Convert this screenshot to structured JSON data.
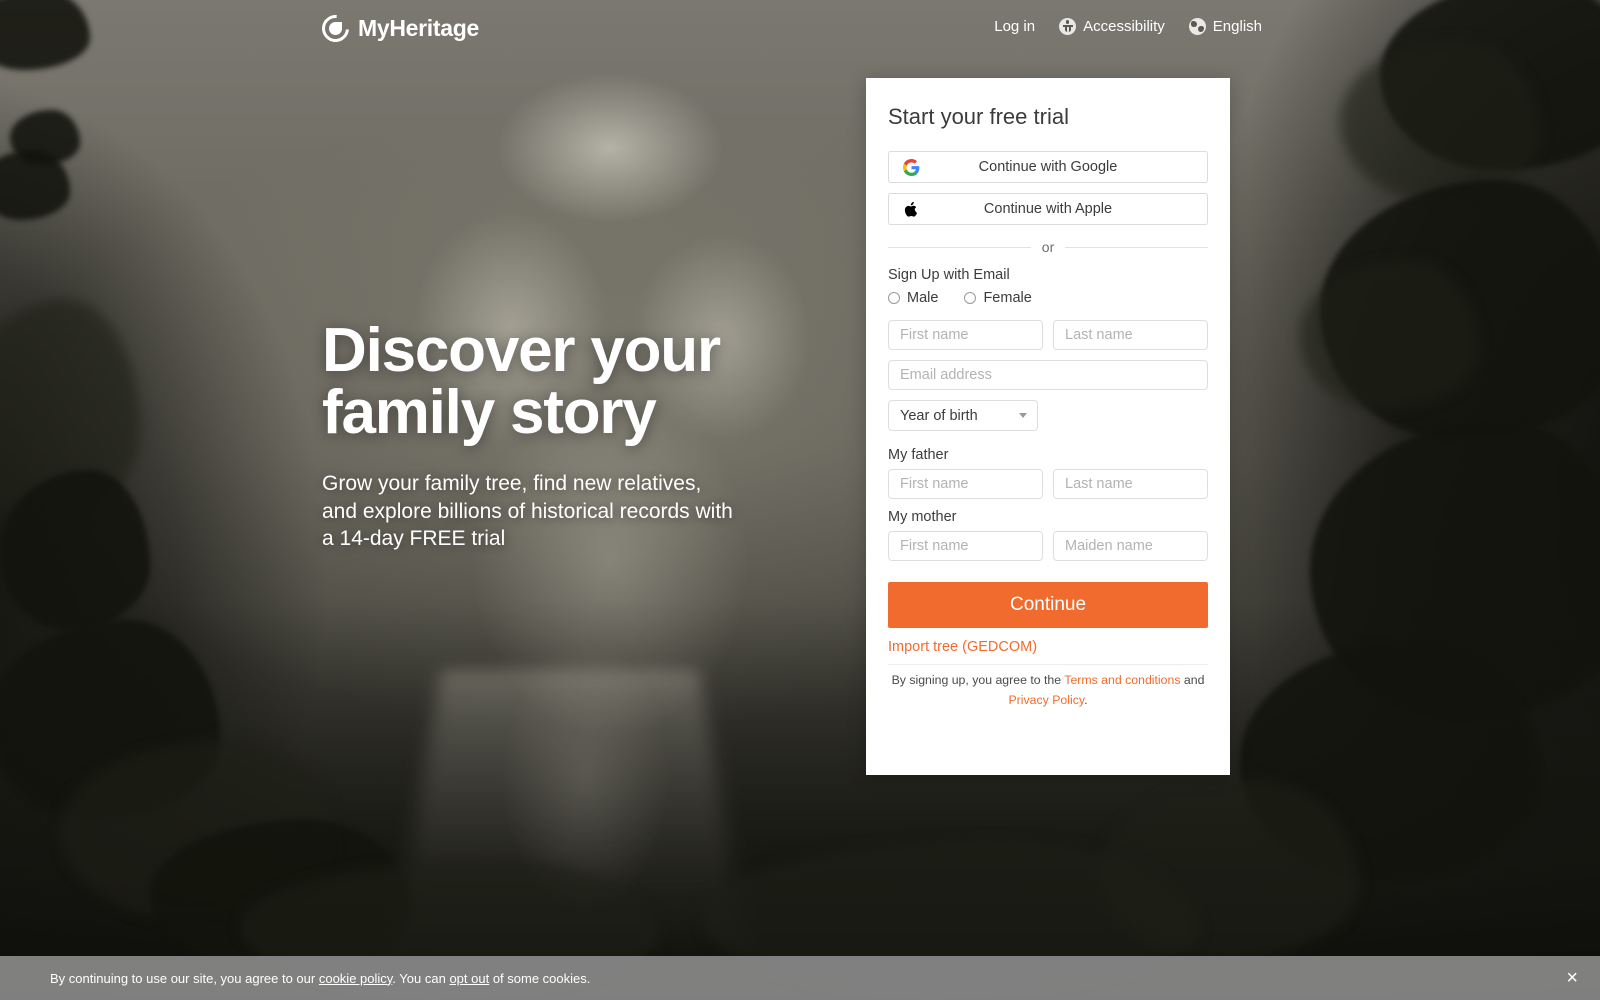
{
  "nav": {
    "logo_text": "MyHeritage",
    "login_label": "Log in",
    "accessibility_label": "Accessibility",
    "language_label": "English"
  },
  "hero": {
    "headline_line1": "Discover your",
    "headline_line2": "family story",
    "subtext": "Grow your family tree, find new relatives, and explore billions of historical records with a 14-day FREE trial"
  },
  "card": {
    "title": "Start your free trial",
    "google_label": "Continue with Google",
    "apple_label": "Continue with Apple",
    "or_label": "or",
    "email_section_label": "Sign Up with Email",
    "gender": {
      "male": "Male",
      "female": "Female"
    },
    "first_name_placeholder": "First name",
    "last_name_placeholder": "Last name",
    "email_placeholder": "Email address",
    "year_of_birth_label": "Year of birth",
    "father_label": "My father",
    "father_first_placeholder": "First name",
    "father_last_placeholder": "Last name",
    "mother_label": "My mother",
    "mother_first_placeholder": "First name",
    "mother_maiden_placeholder": "Maiden name",
    "continue_label": "Continue",
    "gedcom_label": "Import tree (GEDCOM)",
    "terms_prefix": "By signing up, you agree to the ",
    "terms_link": "Terms and conditions",
    "terms_and": " and ",
    "privacy_link": "Privacy Policy",
    "terms_suffix": "."
  },
  "cookie": {
    "prefix": "By continuing to use our site, you agree to our ",
    "policy_link": "cookie policy",
    "middle": ". You can ",
    "optout_link": "opt out",
    "suffix": " of some cookies.",
    "close_label": "×"
  },
  "colors": {
    "accent_orange": "#F26B2E",
    "card_background": "#FFFFFF",
    "cookie_banner": "#898989"
  },
  "icons": {
    "google": "google-g-icon",
    "apple": "apple-logo-icon",
    "accessibility": "accessibility-icon",
    "globe": "globe-icon",
    "close": "close-icon",
    "caret": "chevron-down-icon"
  }
}
